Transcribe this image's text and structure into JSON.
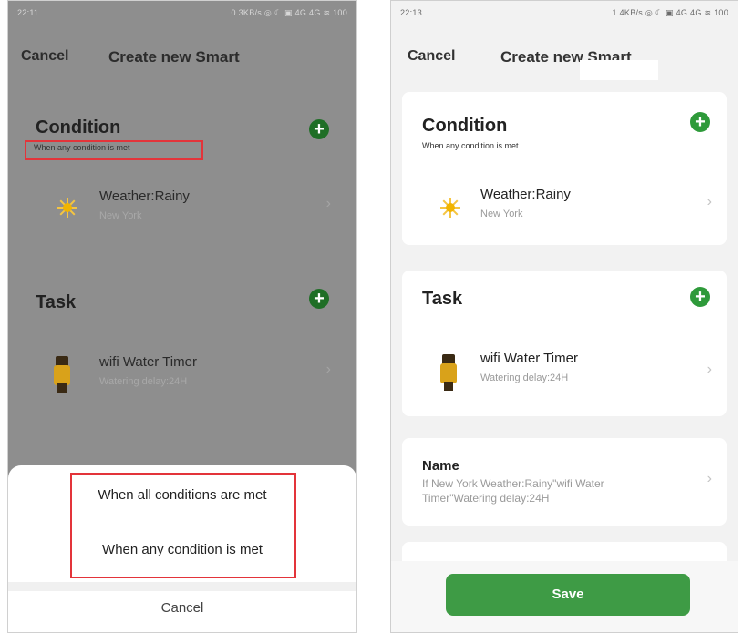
{
  "left_phone": {
    "status_time": "22:11",
    "status_icons": "0.3KB/s ◎ ☾ ▣ 4G 4G ≋ 100",
    "nav": {
      "cancel": "Cancel",
      "title": "Create new Smart"
    },
    "condition": {
      "title": "Condition",
      "mode": "When any condition is met",
      "item": {
        "title": "Weather:Rainy",
        "subtitle": "New York"
      }
    },
    "task": {
      "title": "Task",
      "item": {
        "title": "wifi Water Timer",
        "subtitle": "Watering delay:24H"
      }
    },
    "sheet": {
      "option_all": "When all conditions are met",
      "option_any": "When any condition is met",
      "cancel": "Cancel"
    }
  },
  "right_phone": {
    "status_time": "22:13",
    "status_icons": "1.4KB/s ◎ ☾ ▣ 4G 4G ≋ 100",
    "nav": {
      "cancel": "Cancel",
      "title": "Create new Smart"
    },
    "condition": {
      "title": "Condition",
      "mode": "When any condition is met",
      "item": {
        "title": "Weather:Rainy",
        "subtitle": "New York"
      }
    },
    "task": {
      "title": "Task",
      "item": {
        "title": "wifi Water Timer",
        "subtitle": "Watering delay:24H"
      }
    },
    "name": {
      "label": "Name",
      "value_line1": "If New York Weather:Rainy\"wifi Water",
      "value_line2": "Timer\"Watering delay:24H"
    },
    "save": "Save"
  },
  "colors": {
    "accent_green": "#3e9b45",
    "highlight_red": "#e3343a",
    "overlay_gray": "#8e8e8e"
  },
  "icons": [
    "plus-icon",
    "sun-icon",
    "water-timer-icon",
    "chevron-right-icon"
  ]
}
